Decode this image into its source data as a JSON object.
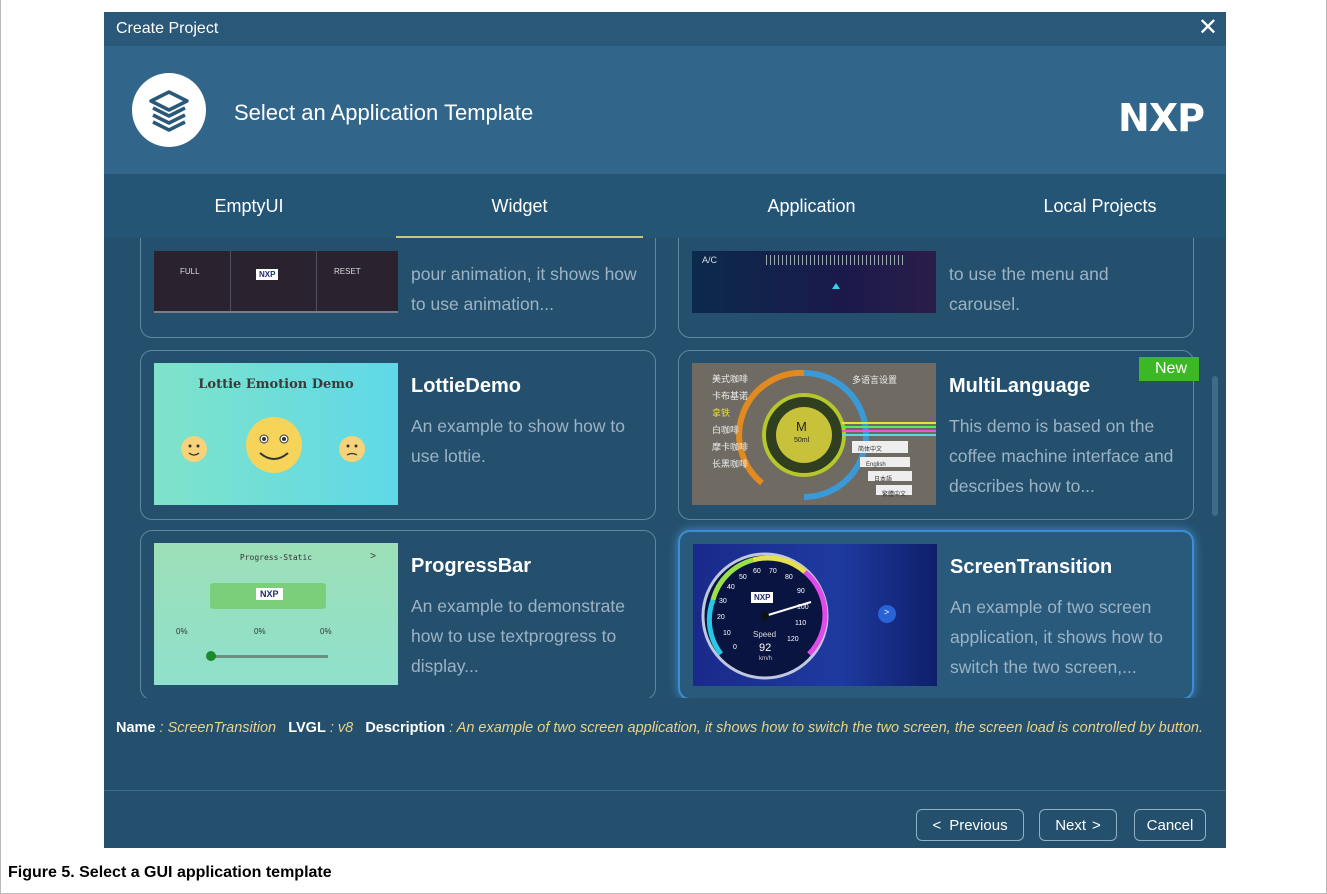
{
  "window": {
    "title": "Create Project"
  },
  "header": {
    "heading": "Select an Application Template",
    "brand": "NXP"
  },
  "tabs": [
    {
      "label": "EmptyUI",
      "active": false
    },
    {
      "label": "Widget",
      "active": true
    },
    {
      "label": "Application",
      "active": false
    },
    {
      "label": "Local Projects",
      "active": false
    }
  ],
  "cards": {
    "partial_left": {
      "desc": "pour animation, it shows how to use animation...",
      "thumb_full": "FULL",
      "thumb_reset": "RESET",
      "thumb_logo": "NXP"
    },
    "partial_right": {
      "desc": "to use the menu and carousel.",
      "thumb_label": "A/C"
    },
    "lottie": {
      "name": "LottieDemo",
      "desc": "An example to show how to use lottie.",
      "thumb_title": "Lottie Emotion Demo"
    },
    "multilang": {
      "name": "MultiLanguage",
      "desc": "This demo is based on the coffee machine interface and describes how to...",
      "badge": "New",
      "thumb_items": [
        "美式咖啡",
        "卡布基诺",
        "拿铁",
        "白咖啡",
        "摩卡咖啡",
        "长黑咖啡"
      ],
      "thumb_heading": "多语言设置",
      "thumb_center": "M",
      "thumb_center_sub": "50ml",
      "thumb_langs": [
        "简体中文",
        "English",
        "日本語",
        "繁體中文"
      ]
    },
    "progress": {
      "name": "ProgressBar",
      "desc": "An example to demonstrate how to use textprogress to display...",
      "thumb_title": "Progress-Static",
      "thumb_arrow": ">",
      "thumb_logo": "NXP",
      "thumb_values": [
        "0%",
        "0%",
        "0%"
      ]
    },
    "screen": {
      "name": "ScreenTransition",
      "desc": "An example of two screen application, it shows how to switch the two screen,...",
      "thumb_logo": "NXP",
      "thumb_label": "Speed",
      "thumb_value": "92",
      "thumb_unit": "km/h",
      "thumb_arrow": ">",
      "thumb_ticks": [
        "0",
        "10",
        "20",
        "30",
        "40",
        "50",
        "60",
        "70",
        "80",
        "90",
        "100",
        "110",
        "120"
      ]
    }
  },
  "info": {
    "name_label": "Name",
    "name_value": "ScreenTransition",
    "lvgl_label": "LVGL",
    "lvgl_value": "v8",
    "desc_label": "Description",
    "desc_value": "An example of two screen application, it shows how to switch the two screen, the screen load is controlled by button.",
    "sep": " : "
  },
  "footer": {
    "previous": "Previous",
    "next": "Next",
    "cancel": "Cancel",
    "prev_glyph": "<",
    "next_glyph": ">"
  },
  "caption": "Figure 5.  Select a GUI application template",
  "colors": {
    "dialog_bg": "#24506d",
    "header_bg": "#31668a",
    "accent_gold": "#e8d28a",
    "badge_green": "#3cb824",
    "selected_glow": "#3b8ed6"
  }
}
